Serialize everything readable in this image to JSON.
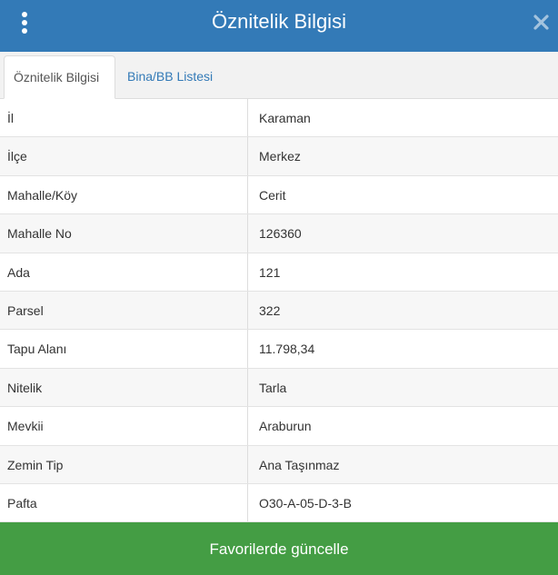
{
  "header": {
    "title": "Öznitelik Bilgisi",
    "menu_icon": "vertical-dots-icon",
    "close_icon": "close-icon",
    "color": "#337ab7"
  },
  "tabs": [
    {
      "label": "Öznitelik Bilgisi",
      "active": true
    },
    {
      "label": "Bina/BB Listesi",
      "active": false
    }
  ],
  "attributes": [
    {
      "key": "İl",
      "value": "Karaman"
    },
    {
      "key": "İlçe",
      "value": "Merkez"
    },
    {
      "key": "Mahalle/Köy",
      "value": "Cerit"
    },
    {
      "key": "Mahalle No",
      "value": "126360"
    },
    {
      "key": "Ada",
      "value": "121"
    },
    {
      "key": "Parsel",
      "value": "322"
    },
    {
      "key": "Tapu Alanı",
      "value": "11.798,34"
    },
    {
      "key": "Nitelik",
      "value": "Tarla"
    },
    {
      "key": "Mevkii",
      "value": "Araburun"
    },
    {
      "key": "Zemin Tip",
      "value": "Ana Taşınmaz"
    },
    {
      "key": "Pafta",
      "value": "O30-A-05-D-3-B"
    }
  ],
  "footer": {
    "button_label": "Favorilerde güncelle",
    "color": "#449d44"
  }
}
